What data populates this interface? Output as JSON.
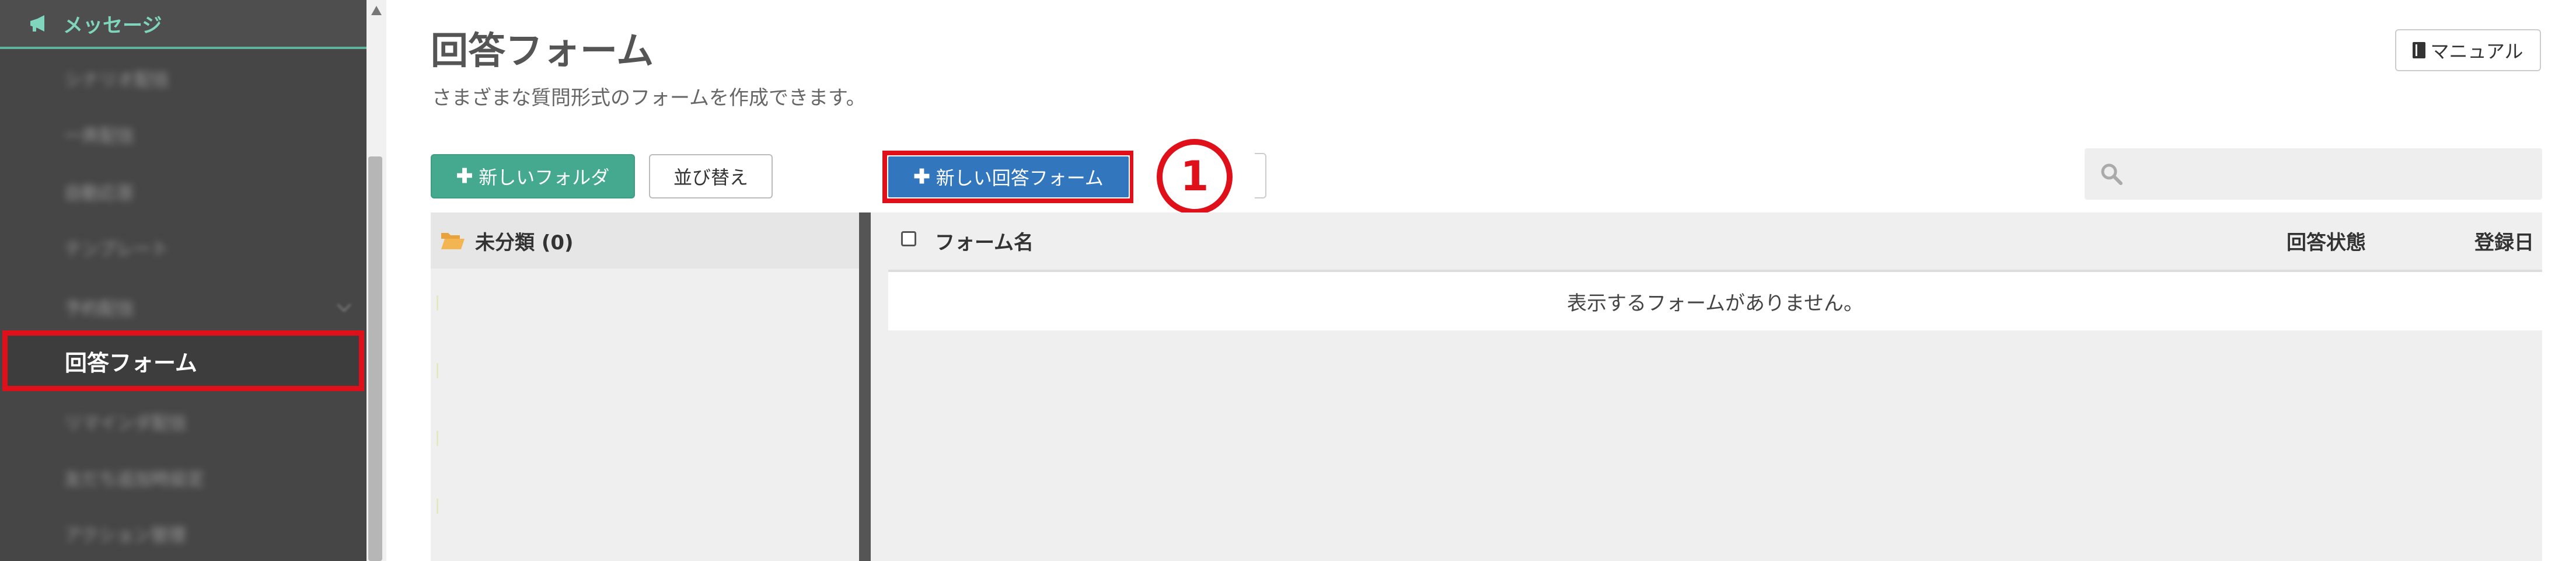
{
  "sidebar": {
    "section_label": "メッセージ",
    "items": [
      {
        "label": "シナリオ配信"
      },
      {
        "label": "一斉配信"
      },
      {
        "label": "自動応答"
      },
      {
        "label": "テンプレート"
      },
      {
        "label": "予約配信"
      },
      {
        "label": "回答フォーム"
      },
      {
        "label": "リマインダ配信"
      },
      {
        "label": "友だち追加時設定"
      },
      {
        "label": "アクション管理"
      }
    ],
    "active_index": 5
  },
  "header": {
    "title": "回答フォーム",
    "subtitle": "さまざまな質問形式のフォームを作成できます。",
    "manual_label": "マニュアル"
  },
  "toolbar": {
    "new_folder_label": "新しいフォルダ",
    "sort_label": "並び替え",
    "new_form_label": "新しい回答フォーム",
    "callout": "①"
  },
  "folders": {
    "unclassified_label": "未分類 (0)"
  },
  "table": {
    "columns": [
      "フォーム名",
      "回答状態",
      "登録日"
    ],
    "empty_message": "表示するフォームがありません。"
  },
  "colors": {
    "sidebar_bg": "#464646",
    "accent_green": "#45a98f",
    "primary_blue": "#3277bd",
    "highlight_red": "#e0101a"
  },
  "icons": {
    "section": "megaphone-icon",
    "manual": "book-icon",
    "folder": "folder-open-icon",
    "search": "search-icon"
  }
}
